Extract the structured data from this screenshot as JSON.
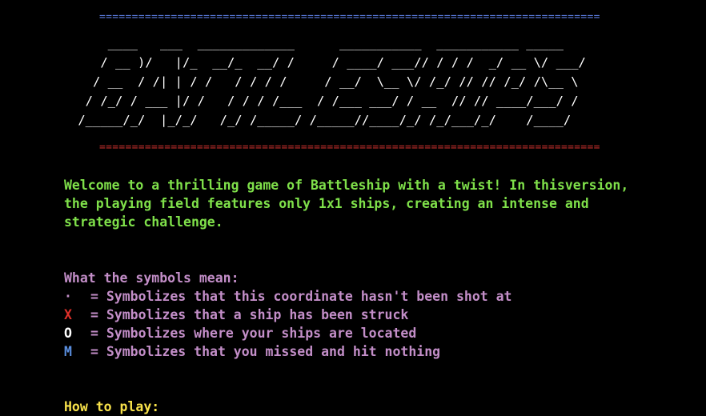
{
  "banner": {
    "rule_top": "=============================================================================",
    "rule_bottom": "=============================================================================",
    "rule_top_color": "#5b7ce0",
    "rule_bottom_color": "#c8302c",
    "ascii_art": "     ____   ___  _____________      ___________  ___________ _____\n    / __ )/   |/_  __/_  __/ /     / ____/ ___// / / /  _/ __ \\/ ___/\n   / __  / /| | / /   / / / /     / __/  \\__ \\/ /_/ // // /_/ /\\__ \\\n  / /_/ / ___ |/ /   / / / /___  / /___ ___/ / __  // // ____/___/ /\n /_____/_/  |_/_/   /_/ /_____/ /_____//____/_/ /_/___/_/    /____/"
  },
  "intro": {
    "lines": [
      "Welcome to a thrilling game of Battleship with a twist! In thisversion,",
      "the playing field features only 1x1 ships, creating an intense and",
      "strategic challenge."
    ],
    "color": "#7fe04a"
  },
  "symbols": {
    "heading": "What the symbols mean:",
    "items": [
      {
        "symbol": "·",
        "color": "#c38ec8",
        "text": "= Symbolizes that this coordinate hasn't been shot at"
      },
      {
        "symbol": "X",
        "color": "#e0302a",
        "text": "= Symbolizes that a ship has been struck"
      },
      {
        "symbol": "O",
        "color": "#ffffff",
        "text": "= Symbolizes where your ships are located"
      },
      {
        "symbol": "M",
        "color": "#5b8fe0",
        "text": "= Symbolizes that you missed and hit nothing"
      }
    ]
  },
  "how_to_play": {
    "heading": "How to play:",
    "color": "#f7e14a"
  }
}
